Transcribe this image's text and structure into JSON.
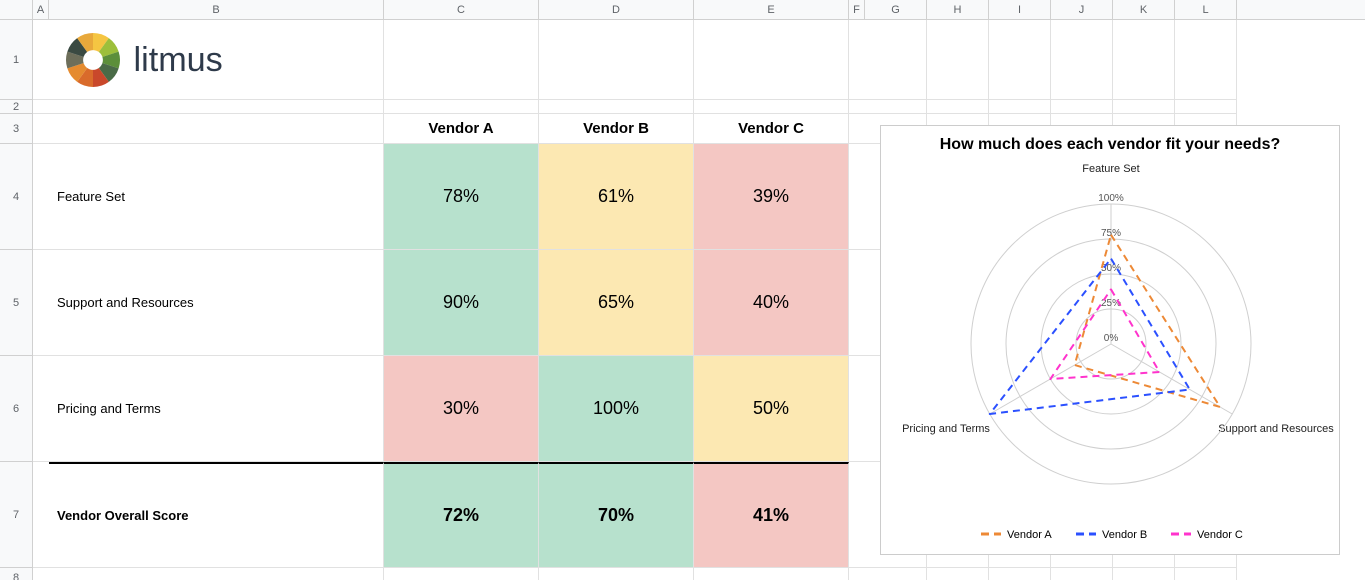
{
  "columns": [
    "A",
    "B",
    "C",
    "D",
    "E",
    "F",
    "G",
    "H",
    "I",
    "J",
    "K",
    "L"
  ],
  "row_numbers": [
    "1",
    "2",
    "3",
    "4",
    "5",
    "6",
    "7",
    "8"
  ],
  "logo_text": "litmus",
  "header": {
    "vendor_a": "Vendor A",
    "vendor_b": "Vendor B",
    "vendor_c": "Vendor C"
  },
  "rows": {
    "feature_set": {
      "label": "Feature Set",
      "a": "78%",
      "b": "61%",
      "c": "39%"
    },
    "support_resources": {
      "label": "Support and Resources",
      "a": "90%",
      "b": "65%",
      "c": "40%"
    },
    "pricing_terms": {
      "label": "Pricing and Terms",
      "a": "30%",
      "b": "100%",
      "c": "50%"
    },
    "overall": {
      "label": "Vendor Overall Score",
      "a": "72%",
      "b": "70%",
      "c": "41%"
    }
  },
  "chart": {
    "title": "How much does each vendor fit your needs?",
    "axis_top": "Feature Set",
    "axis_right": "Support and Resources",
    "axis_left": "Pricing and Terms",
    "ticks": [
      "0%",
      "25%",
      "50%",
      "75%",
      "100%"
    ],
    "legend": {
      "a": "Vendor A",
      "b": "Vendor B",
      "c": "Vendor C"
    }
  },
  "chart_data": {
    "type": "radar",
    "categories": [
      "Feature Set",
      "Support and Resources",
      "Pricing and Terms"
    ],
    "series": [
      {
        "name": "Vendor A",
        "color": "#ed8936",
        "values": [
          78,
          90,
          30
        ]
      },
      {
        "name": "Vendor B",
        "color": "#2b50ff",
        "values": [
          61,
          65,
          100
        ]
      },
      {
        "name": "Vendor C",
        "color": "#ff33cc",
        "values": [
          39,
          40,
          50
        ]
      }
    ],
    "ticks": [
      0,
      25,
      50,
      75,
      100
    ],
    "max": 100,
    "title": "How much does each vendor fit your needs?"
  }
}
